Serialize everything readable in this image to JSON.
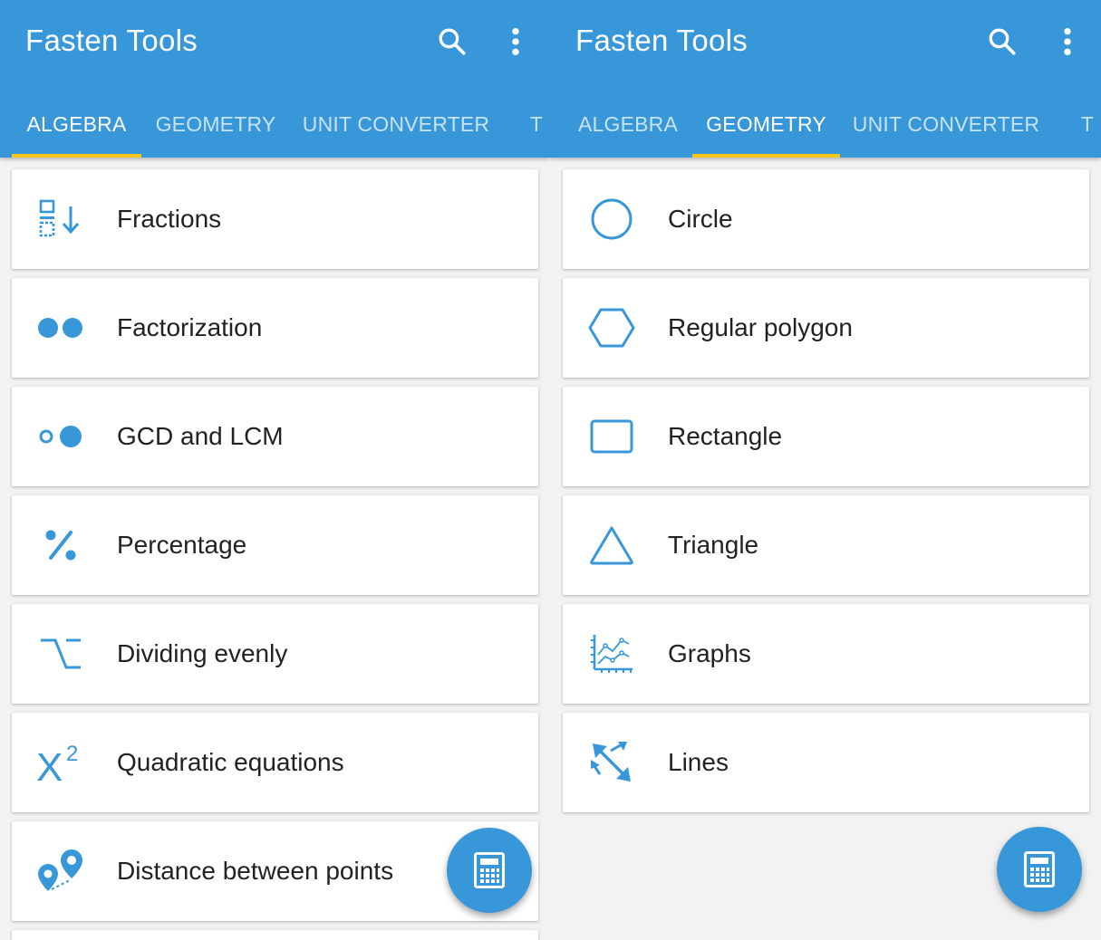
{
  "colors": {
    "primary": "#3897d9",
    "tab_indicator": "#f5c518",
    "background": "#f2f2f2",
    "card": "#ffffff",
    "text": "#222222"
  },
  "screens": [
    {
      "app_title": "Fasten Tools",
      "tabs": [
        {
          "label": "ALGEBRA",
          "active": true
        },
        {
          "label": "GEOMETRY",
          "active": false
        },
        {
          "label": "UNIT CONVERTER",
          "active": false
        },
        {
          "label": "T",
          "active": false
        }
      ],
      "items": [
        {
          "label": "Fractions",
          "icon": "fractions-icon"
        },
        {
          "label": "Factorization",
          "icon": "factorization-icon"
        },
        {
          "label": "GCD and LCM",
          "icon": "gcd-lcm-icon"
        },
        {
          "label": "Percentage",
          "icon": "percent-icon"
        },
        {
          "label": "Dividing evenly",
          "icon": "dividing-icon"
        },
        {
          "label": "Quadratic equations",
          "icon": "x-squared-icon"
        },
        {
          "label": "Distance between points",
          "icon": "map-pins-icon"
        }
      ],
      "fab_icon": "calculator-icon"
    },
    {
      "app_title": "Fasten Tools",
      "tabs": [
        {
          "label": "ALGEBRA",
          "active": false
        },
        {
          "label": "GEOMETRY",
          "active": true
        },
        {
          "label": "UNIT CONVERTER",
          "active": false
        },
        {
          "label": "T",
          "active": false
        }
      ],
      "items": [
        {
          "label": "Circle",
          "icon": "circle-icon"
        },
        {
          "label": "Regular polygon",
          "icon": "hexagon-icon"
        },
        {
          "label": "Rectangle",
          "icon": "rectangle-icon"
        },
        {
          "label": "Triangle",
          "icon": "triangle-icon"
        },
        {
          "label": "Graphs",
          "icon": "graph-icon"
        },
        {
          "label": "Lines",
          "icon": "lines-arrows-icon"
        }
      ],
      "fab_icon": "calculator-icon"
    }
  ],
  "toolbar_icons": [
    "search-icon",
    "more-vert-icon"
  ],
  "quadratic_icon_text": {
    "base": "X",
    "exponent": "2"
  }
}
